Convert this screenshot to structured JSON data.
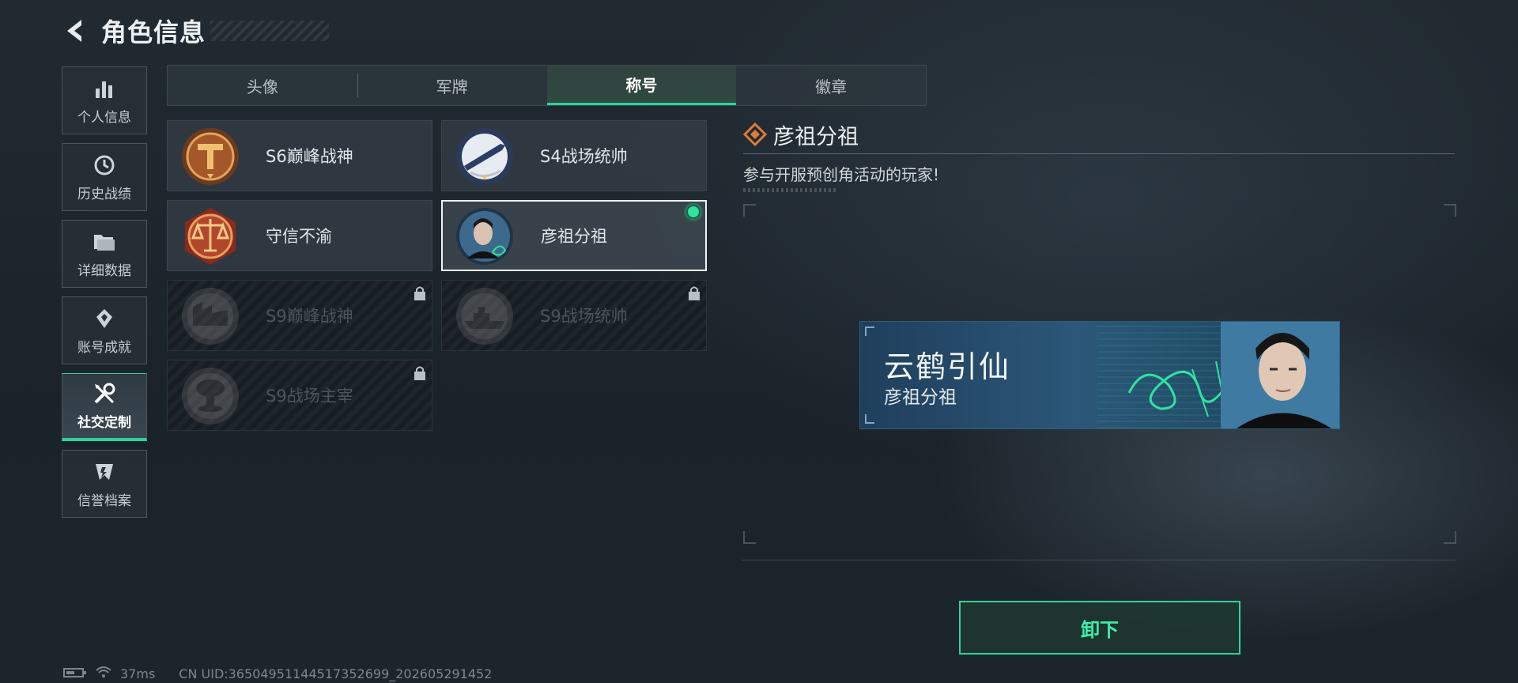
{
  "header": {
    "title": "角色信息"
  },
  "sidebar": {
    "items": [
      {
        "label": "个人信息",
        "icon": "bar-chart-icon"
      },
      {
        "label": "历史战绩",
        "icon": "clock-icon"
      },
      {
        "label": "详细数据",
        "icon": "folder-icon"
      },
      {
        "label": "账号成就",
        "icon": "achievement-icon"
      },
      {
        "label": "社交定制",
        "icon": "tools-icon",
        "active": true
      },
      {
        "label": "信誉档案",
        "icon": "shield-badge-icon"
      }
    ]
  },
  "tabs": [
    {
      "label": "头像"
    },
    {
      "label": "军牌"
    },
    {
      "label": "称号",
      "active": true
    },
    {
      "label": "徽章"
    }
  ],
  "titles": [
    {
      "label": "S6巅峰战神",
      "icon": "hammer-medal-icon",
      "state": "owned"
    },
    {
      "label": "S4战场统帅",
      "icon": "missile-medal-icon",
      "state": "owned"
    },
    {
      "label": "守信不渝",
      "icon": "scales-medal-icon",
      "state": "owned"
    },
    {
      "label": "彦祖分祖",
      "icon": "portrait-medal-icon",
      "state": "equipped"
    },
    {
      "label": "S9巅峰战神",
      "icon": "fortress-medal-icon",
      "state": "locked"
    },
    {
      "label": "S9战场统帅",
      "icon": "warship-medal-icon",
      "state": "locked"
    },
    {
      "label": "S9战场主宰",
      "icon": "mushroom-cloud-medal-icon",
      "state": "locked"
    }
  ],
  "detail": {
    "title": "彦祖分祖",
    "description": "参与开服预创角活动的玩家!"
  },
  "preview": {
    "line1": "云鹤引仙",
    "line2": "彦祖分祖"
  },
  "actions": {
    "unequip_label": "卸下"
  },
  "status": {
    "ping": "37ms",
    "uid": "CN UID:36504951144517352699_202605291452"
  },
  "colors": {
    "accent": "#2fd29a",
    "background": "#1e262d"
  }
}
